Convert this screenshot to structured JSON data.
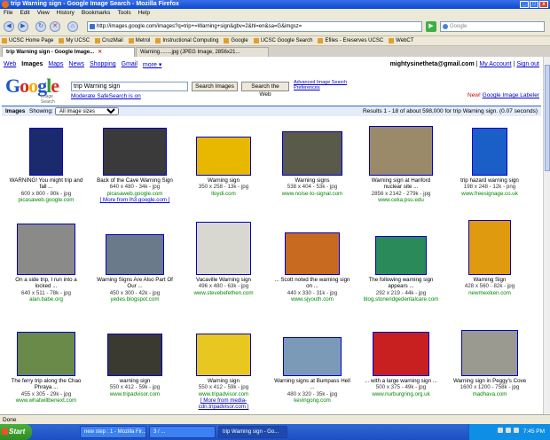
{
  "window": {
    "title": "trip Warning sign - Google Image Search - Mozilla Firefox"
  },
  "menu": [
    "File",
    "Edit",
    "View",
    "History",
    "Bookmarks",
    "Tools",
    "Help"
  ],
  "url": "http://images.google.com/images?q=trip+=Warning+sign&gbv=2&hl=en&sa=G&imgsz=",
  "search_placeholder": "Google",
  "bookmarks": [
    "UCSC Home Page",
    "My UCSC",
    "CruzMail",
    "Metrol",
    "Instructional Computing",
    "Google",
    "UCSC Google Search",
    "Efiles - Ereserves UCSC",
    "WebCT"
  ],
  "tabs": [
    {
      "label": "trip Warning sign - Google Image...",
      "active": true
    },
    {
      "label": "Warning........jpg (JPEG Image, 2856x21...",
      "active": false
    }
  ],
  "gbar": [
    "Web",
    "Images",
    "Maps",
    "News",
    "Shopping",
    "Gmail",
    "more ▾"
  ],
  "user": {
    "email": "mightysinetheta@gmail.com",
    "account": "My Account",
    "signout": "Sign out"
  },
  "logo": {
    "text": "Google",
    "sub": "Image Search"
  },
  "query": "trip Warning sign",
  "buttons": {
    "search_images": "Search Images",
    "search_web": "Search the Web"
  },
  "adv": {
    "advanced": "Advanced Image Search",
    "prefs": "Preferences"
  },
  "safesearch": "Moderate SafeSearch is on",
  "labeler": {
    "new": "New!",
    "link": "Google Image Labeler"
  },
  "results_bar": {
    "label": "Images",
    "showing": "Showing:",
    "select": "All image sizes",
    "stats": "Results 1 - 18 of about 598,000 for trip Warning sign. (0.07 seconds)"
  },
  "results": [
    {
      "cap": "WARNING! You might trip and fall ...",
      "meta": "600 x 800 - 90k - jpg",
      "site": "picasaweb.google.com",
      "color": "#1a2a6c"
    },
    {
      "cap": "Back of the Cave Warning Sign",
      "meta": "640 x 480 - 34k - jpg",
      "site": "picasaweb.google.com",
      "more": "[ More from lh3.google.com ]",
      "color": "#3a3a3a"
    },
    {
      "cap": "Warning sign",
      "meta": "350 x 258 - 13k - jpg",
      "site": "lloydi.com",
      "color": "#e8b800"
    },
    {
      "cap": "Warning signs",
      "meta": "538 x 404 - 53k - jpg",
      "site": "www.noise-to-signal.com",
      "color": "#5a5a4a"
    },
    {
      "cap": "Warning sign at Hanford nuclear site ...",
      "meta": "2856 x 2142 - 279k - jpg",
      "site": "www.ceka.psu.edu",
      "color": "#9a8a6a"
    },
    {
      "cap": "trip hazard warning sign",
      "meta": "198 x 248 - 12k - png",
      "site": "www.freesignage.co.uk",
      "color": "#1a5fc8"
    },
    {
      "cap": "On a side trip, I run into a locked ...",
      "meta": "640 x 511 - 78k - jpg",
      "site": "alan.babe.org",
      "color": "#8a8a88"
    },
    {
      "cap": "Warning Signs Are Also Part Of Our ...",
      "meta": "450 x 300 - 42k - jpg",
      "site": "yedes.blogspot.com",
      "color": "#6a7a8a"
    },
    {
      "cap": "Vacaville Warning sign",
      "meta": "496 x 480 - 63k - jpg",
      "site": "www.stevebefethen.com",
      "color": "#d8d8d0"
    },
    {
      "cap": "... Scott noted the warning sign on ...",
      "meta": "440 x 330 - 31k - jpg",
      "site": "www.sjyouth.com",
      "color": "#c86a20"
    },
    {
      "cap": "The following warning sign appears ...",
      "meta": "292 x 219 - 44k - jpg",
      "site": "blog.stoneridgedentalcare.com",
      "color": "#2a8a5a"
    },
    {
      "cap": "Warning Sign",
      "meta": "428 x 560 - 82k - jpg",
      "site": "newmexiken.com",
      "color": "#e09a10"
    },
    {
      "cap": "The ferry trip along the Chao Phraya ...",
      "meta": "455 x 305 - 29k - jpg",
      "site": "www.whatwillbenext.com",
      "color": "#6a8a4a"
    },
    {
      "cap": "warning sign",
      "meta": "550 x 412 - 59k - jpg",
      "site": "www.tripadvisor.com",
      "color": "#3a3a30"
    },
    {
      "cap": "Warning sign",
      "meta": "550 x 412 - 59k - jpg",
      "site": "www.tripadvisor.com",
      "more": "[ More from media-cdn.tripadvisor.com ]",
      "color": "#e8c820"
    },
    {
      "cap": "Warning signs at Bumpass Hell ...",
      "meta": "480 x 320 - 35k - jpg",
      "site": "kevingong.com",
      "color": "#7a9ab8"
    },
    {
      "cap": "... with a large warning sign ...",
      "meta": "500 x 375 - 49k - jpg",
      "site": "www.nurburgring.org.uk",
      "color": "#c82020"
    },
    {
      "cap": "Warning sign in Peggy's Cove",
      "meta": "1600 x 1200 - 758k - jpg",
      "site": "madhava.com",
      "color": "#9a9a90"
    }
  ],
  "status": "Done",
  "taskbar": {
    "start": "Start",
    "tasks": [
      "new step : 1 - Mozilla Fir...",
      "3 / ...",
      "trip Warning sign - Go..."
    ],
    "time": "7:45 PM"
  }
}
